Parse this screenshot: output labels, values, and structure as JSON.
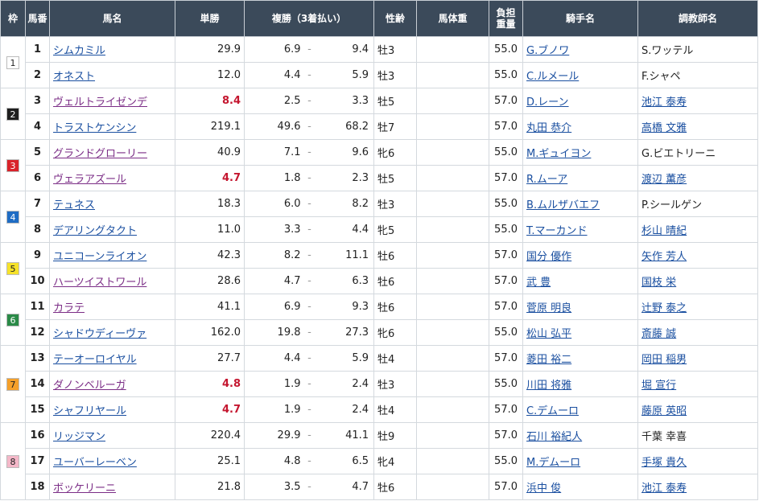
{
  "headers": {
    "frame": "枠",
    "number": "馬番",
    "horse": "馬名",
    "win": "単勝",
    "place": "複勝（3着払い）",
    "sexage": "性齢",
    "weight": "馬体重",
    "burden": "負担重量",
    "jockey": "騎手名",
    "trainer": "調教師名"
  },
  "frames": [
    {
      "label": "1",
      "bg": "#ffffff",
      "fg": "#222222",
      "rows": 2
    },
    {
      "label": "2",
      "bg": "#1e1e1e",
      "fg": "#ffffff",
      "rows": 2
    },
    {
      "label": "3",
      "bg": "#d9232a",
      "fg": "#ffffff",
      "rows": 2
    },
    {
      "label": "4",
      "bg": "#1f6cc4",
      "fg": "#ffffff",
      "rows": 2
    },
    {
      "label": "5",
      "bg": "#f6e22a",
      "fg": "#222222",
      "rows": 2
    },
    {
      "label": "6",
      "bg": "#2a8a47",
      "fg": "#ffffff",
      "rows": 2
    },
    {
      "label": "7",
      "bg": "#f5a02a",
      "fg": "#222222",
      "rows": 3
    },
    {
      "label": "8",
      "bg": "#f4b7c8",
      "fg": "#222222",
      "rows": 3
    }
  ],
  "rows": [
    {
      "num": "1",
      "horse": "シムカミル",
      "visited": false,
      "win": "29.9",
      "pop": false,
      "pl_min": "6.9",
      "pl_sep": "-",
      "pl_max": "9.4",
      "sexage": "牡3",
      "weight": "",
      "burden": "55.0",
      "jockey": "G.ブノワ",
      "jockey_link": true,
      "trainer": "S.ワッテル",
      "trainer_link": false
    },
    {
      "num": "2",
      "horse": "オネスト",
      "visited": false,
      "win": "12.0",
      "pop": false,
      "pl_min": "4.4",
      "pl_sep": "-",
      "pl_max": "5.9",
      "sexage": "牡3",
      "weight": "",
      "burden": "55.0",
      "jockey": "C.ルメール",
      "jockey_link": true,
      "trainer": "F.シャペ",
      "trainer_link": false
    },
    {
      "num": "3",
      "horse": "ヴェルトライゼンデ",
      "visited": true,
      "win": "8.4",
      "pop": true,
      "pl_min": "2.5",
      "pl_sep": "-",
      "pl_max": "3.3",
      "sexage": "牡5",
      "weight": "",
      "burden": "57.0",
      "jockey": "D.レーン",
      "jockey_link": true,
      "trainer": "池江 泰寿",
      "trainer_link": true
    },
    {
      "num": "4",
      "horse": "トラストケンシン",
      "visited": false,
      "win": "219.1",
      "pop": false,
      "pl_min": "49.6",
      "pl_sep": "-",
      "pl_max": "68.2",
      "sexage": "牡7",
      "weight": "",
      "burden": "57.0",
      "jockey": "丸田 恭介",
      "jockey_link": true,
      "trainer": "高橋 文雅",
      "trainer_link": true
    },
    {
      "num": "5",
      "horse": "グランドグローリー",
      "visited": true,
      "win": "40.9",
      "pop": false,
      "pl_min": "7.1",
      "pl_sep": "-",
      "pl_max": "9.6",
      "sexage": "牝6",
      "weight": "",
      "burden": "55.0",
      "jockey": "M.ギュイヨン",
      "jockey_link": true,
      "trainer": "G.ビエトリーニ",
      "trainer_link": false
    },
    {
      "num": "6",
      "horse": "ヴェラアズール",
      "visited": true,
      "win": "4.7",
      "pop": true,
      "pl_min": "1.8",
      "pl_sep": "-",
      "pl_max": "2.3",
      "sexage": "牡5",
      "weight": "",
      "burden": "57.0",
      "jockey": "R.ムーア",
      "jockey_link": true,
      "trainer": "渡辺 薫彦",
      "trainer_link": true
    },
    {
      "num": "7",
      "horse": "テュネス",
      "visited": false,
      "win": "18.3",
      "pop": false,
      "pl_min": "6.0",
      "pl_sep": "-",
      "pl_max": "8.2",
      "sexage": "牡3",
      "weight": "",
      "burden": "55.0",
      "jockey": "B.ムルザバエフ",
      "jockey_link": true,
      "trainer": "P.シールゲン",
      "trainer_link": false
    },
    {
      "num": "8",
      "horse": "デアリングタクト",
      "visited": false,
      "win": "11.0",
      "pop": false,
      "pl_min": "3.3",
      "pl_sep": "-",
      "pl_max": "4.4",
      "sexage": "牝5",
      "weight": "",
      "burden": "55.0",
      "jockey": "T.マーカンド",
      "jockey_link": true,
      "trainer": "杉山 晴紀",
      "trainer_link": true
    },
    {
      "num": "9",
      "horse": "ユニコーンライオン",
      "visited": false,
      "win": "42.3",
      "pop": false,
      "pl_min": "8.2",
      "pl_sep": "-",
      "pl_max": "11.1",
      "sexage": "牡6",
      "weight": "",
      "burden": "57.0",
      "jockey": "国分 優作",
      "jockey_link": true,
      "trainer": "矢作 芳人",
      "trainer_link": true
    },
    {
      "num": "10",
      "horse": "ハーツイストワール",
      "visited": true,
      "win": "28.6",
      "pop": false,
      "pl_min": "4.7",
      "pl_sep": "-",
      "pl_max": "6.3",
      "sexage": "牡6",
      "weight": "",
      "burden": "57.0",
      "jockey": "武 豊",
      "jockey_link": true,
      "trainer": "国枝 栄",
      "trainer_link": true
    },
    {
      "num": "11",
      "horse": "カラテ",
      "visited": true,
      "win": "41.1",
      "pop": false,
      "pl_min": "6.9",
      "pl_sep": "-",
      "pl_max": "9.3",
      "sexage": "牡6",
      "weight": "",
      "burden": "57.0",
      "jockey": "菅原 明良",
      "jockey_link": true,
      "trainer": "辻野 泰之",
      "trainer_link": true
    },
    {
      "num": "12",
      "horse": "シャドウディーヴァ",
      "visited": false,
      "win": "162.0",
      "pop": false,
      "pl_min": "19.8",
      "pl_sep": "-",
      "pl_max": "27.3",
      "sexage": "牝6",
      "weight": "",
      "burden": "55.0",
      "jockey": "松山 弘平",
      "jockey_link": true,
      "trainer": "斎藤 誠",
      "trainer_link": true
    },
    {
      "num": "13",
      "horse": "テーオーロイヤル",
      "visited": false,
      "win": "27.7",
      "pop": false,
      "pl_min": "4.4",
      "pl_sep": "-",
      "pl_max": "5.9",
      "sexage": "牡4",
      "weight": "",
      "burden": "57.0",
      "jockey": "菱田 裕二",
      "jockey_link": true,
      "trainer": "岡田 稲男",
      "trainer_link": true
    },
    {
      "num": "14",
      "horse": "ダノンベルーガ",
      "visited": true,
      "win": "4.8",
      "pop": true,
      "pl_min": "1.9",
      "pl_sep": "-",
      "pl_max": "2.4",
      "sexage": "牡3",
      "weight": "",
      "burden": "55.0",
      "jockey": "川田 将雅",
      "jockey_link": true,
      "trainer": "堀 宣行",
      "trainer_link": true
    },
    {
      "num": "15",
      "horse": "シャフリヤール",
      "visited": false,
      "win": "4.7",
      "pop": true,
      "pl_min": "1.9",
      "pl_sep": "-",
      "pl_max": "2.4",
      "sexage": "牡4",
      "weight": "",
      "burden": "57.0",
      "jockey": "C.デムーロ",
      "jockey_link": true,
      "trainer": "藤原 英昭",
      "trainer_link": true
    },
    {
      "num": "16",
      "horse": "リッジマン",
      "visited": false,
      "win": "220.4",
      "pop": false,
      "pl_min": "29.9",
      "pl_sep": "-",
      "pl_max": "41.1",
      "sexage": "牡9",
      "weight": "",
      "burden": "57.0",
      "jockey": "石川 裕紀人",
      "jockey_link": true,
      "trainer": "千葉 幸喜",
      "trainer_link": false
    },
    {
      "num": "17",
      "horse": "ユーバーレーベン",
      "visited": false,
      "win": "25.1",
      "pop": false,
      "pl_min": "4.8",
      "pl_sep": "-",
      "pl_max": "6.5",
      "sexage": "牝4",
      "weight": "",
      "burden": "55.0",
      "jockey": "M.デムーロ",
      "jockey_link": true,
      "trainer": "手塚 貴久",
      "trainer_link": true
    },
    {
      "num": "18",
      "horse": "ボッケリーニ",
      "visited": true,
      "win": "21.8",
      "pop": false,
      "pl_min": "3.5",
      "pl_sep": "-",
      "pl_max": "4.7",
      "sexage": "牡6",
      "weight": "",
      "burden": "57.0",
      "jockey": "浜中 俊",
      "jockey_link": true,
      "trainer": "池江 泰寿",
      "trainer_link": true
    }
  ]
}
